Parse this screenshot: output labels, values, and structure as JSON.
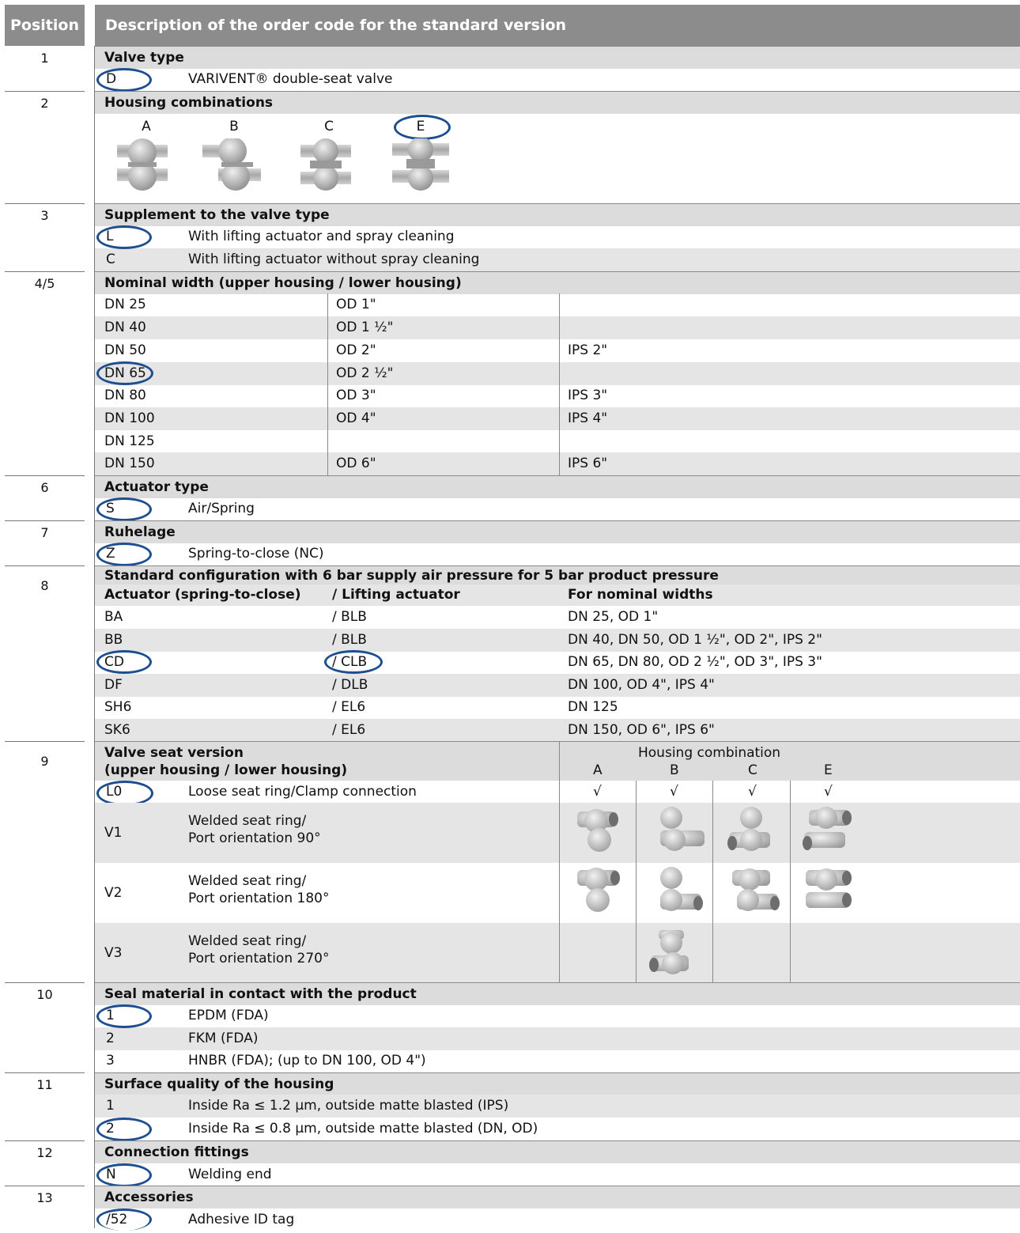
{
  "header": {
    "position": "Position",
    "description": "Description of the order code for the standard version"
  },
  "positions": [
    "1",
    "2",
    "3",
    "4/5",
    "6",
    "7",
    "8",
    "9",
    "10",
    "11",
    "12",
    "13"
  ],
  "s1": {
    "title": "Valve type",
    "code": "D",
    "text": "VARIVENT® double-seat valve"
  },
  "s2": {
    "title": "Housing combinations",
    "labels": [
      "A",
      "B",
      "C",
      "E"
    ]
  },
  "s3": {
    "title": "Supplement to the valve type",
    "rows": [
      {
        "code": "L",
        "text": "With lifting actuator and spray cleaning"
      },
      {
        "code": "C",
        "text": "With lifting actuator without spray cleaning"
      }
    ]
  },
  "s45": {
    "title": "Nominal width (upper housing / lower housing)",
    "rows": [
      [
        "DN 25",
        "OD 1\"",
        ""
      ],
      [
        "DN 40",
        "OD 1 ½\"",
        ""
      ],
      [
        "DN 50",
        "OD 2\"",
        "IPS 2\""
      ],
      [
        "DN 65",
        "OD 2 ½\"",
        ""
      ],
      [
        "DN 80",
        "OD 3\"",
        "IPS 3\""
      ],
      [
        "DN 100",
        "OD 4\"",
        "IPS 4\""
      ],
      [
        "DN 125",
        "",
        ""
      ],
      [
        "DN 150",
        "OD 6\"",
        "IPS 6\""
      ]
    ]
  },
  "s6": {
    "title": "Actuator type",
    "code": "S",
    "text": "Air/Spring"
  },
  "s7": {
    "title": "Ruhelage",
    "code": "Z",
    "text": "Spring-to-close (NC)"
  },
  "s8": {
    "title": "Standard configuration with 6 bar supply air pressure for 5 bar product pressure",
    "headers": [
      "Actuator (spring-to-close)",
      "/ Lifting actuator",
      "For nominal widths"
    ],
    "rows": [
      [
        "BA",
        "/ BLB",
        "DN 25, OD 1\""
      ],
      [
        "BB",
        "/ BLB",
        "DN 40, DN 50, OD 1 ½\", OD 2\", IPS 2\""
      ],
      [
        "CD",
        "/ CLB",
        "DN 65, DN 80, OD 2 ½\", OD 3\", IPS 3\""
      ],
      [
        "DF",
        "/ DLB",
        "DN 100, OD 4\", IPS 4\""
      ],
      [
        "SH6",
        "/ EL6",
        "DN 125"
      ],
      [
        "SK6",
        "/ EL6",
        "DN 150, OD 6\", IPS 6\""
      ]
    ]
  },
  "s9": {
    "title1": "Valve seat version",
    "title2": "(upper housing / lower housing)",
    "hc_title": "Housing combination",
    "hc_labels": [
      "A",
      "B",
      "C",
      "E"
    ],
    "l0": {
      "code": "L0",
      "text": "Loose seat ring/Clamp connection",
      "checks": [
        "√",
        "√",
        "√",
        "√"
      ]
    },
    "v": [
      {
        "code": "V1",
        "l1": "Welded seat ring/",
        "l2": "Port orientation 90°"
      },
      {
        "code": "V2",
        "l1": "Welded seat ring/",
        "l2": "Port orientation 180°"
      },
      {
        "code": "V3",
        "l1": "Welded seat ring/",
        "l2": "Port orientation 270°"
      }
    ]
  },
  "s10": {
    "title": "Seal material in contact with the product",
    "rows": [
      {
        "code": "1",
        "text": "EPDM (FDA)"
      },
      {
        "code": "2",
        "text": "FKM (FDA)"
      },
      {
        "code": "3",
        "text": "HNBR (FDA); (up to DN 100, OD 4\")"
      }
    ]
  },
  "s11": {
    "title": "Surface quality of the housing",
    "rows": [
      {
        "code": "1",
        "text": "Inside Ra ≤ 1.2 µm, outside matte blasted (IPS)"
      },
      {
        "code": "2",
        "text": "Inside Ra ≤ 0.8 µm, outside matte blasted (DN, OD)"
      }
    ]
  },
  "s12": {
    "title": "Connection fittings",
    "code": "N",
    "text": "Welding end"
  },
  "s13": {
    "title": "Accessories",
    "code": "/52",
    "text": "Adhesive ID tag"
  },
  "colors": {
    "header_bg": "#8c8c8c",
    "row_gray": "#e5e5e5",
    "oval": "#1d4e8f"
  }
}
